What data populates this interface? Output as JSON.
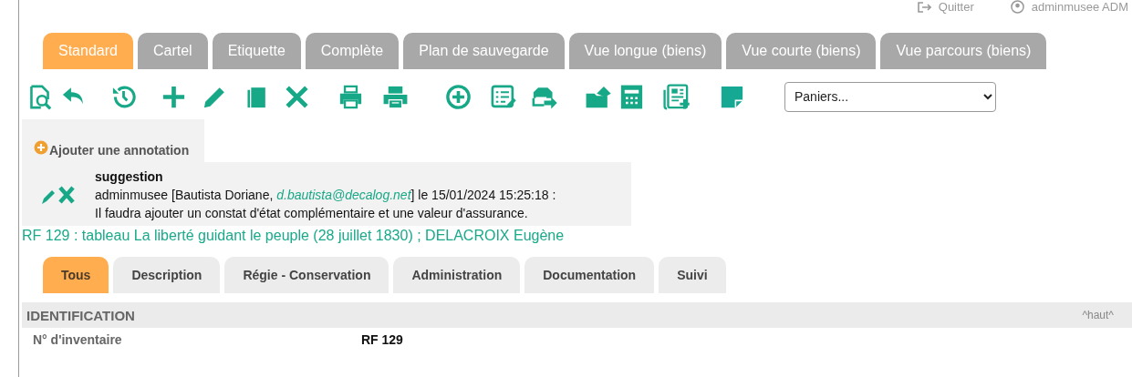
{
  "header": {
    "quit_link": "Quitter",
    "user": "adminmusee ADM"
  },
  "view_tabs": [
    {
      "label": "Standard",
      "selected": true
    },
    {
      "label": "Cartel",
      "selected": false
    },
    {
      "label": "Etiquette",
      "selected": false
    },
    {
      "label": "Complète",
      "selected": false
    },
    {
      "label": "Plan de sauvegarde",
      "selected": false
    },
    {
      "label": "Vue longue (biens)",
      "selected": false
    },
    {
      "label": "Vue courte (biens)",
      "selected": false
    },
    {
      "label": "Vue parcours (biens)",
      "selected": false
    }
  ],
  "basket_select": {
    "value": "Paniers..."
  },
  "annotation": {
    "add_link": "Ajouter une annotation",
    "note": {
      "type": "suggestion",
      "prefix": "adminmusee [Bautista Doriane, ",
      "email": "d.bautista@decalog.net",
      "suffix": "] le 15/01/2024 15:25:18 :",
      "text": "Il faudra ajouter un constat d'état complémentaire et une valeur d'assurance."
    }
  },
  "record_title": "RF 129 : tableau La liberté guidant le peuple (28 juillet 1830) ; DELACROIX Eugène",
  "section_tabs": [
    {
      "label": "Tous",
      "selected": true
    },
    {
      "label": "Description",
      "selected": false
    },
    {
      "label": "Régie - Conservation",
      "selected": false
    },
    {
      "label": "Administration",
      "selected": false
    },
    {
      "label": "Documentation",
      "selected": false
    },
    {
      "label": "Suivi",
      "selected": false
    }
  ],
  "section": {
    "title": "IDENTIFICATION",
    "top_link": "^haut^",
    "fields": [
      {
        "label": "N° d'inventaire",
        "value": "RF 129"
      }
    ]
  }
}
